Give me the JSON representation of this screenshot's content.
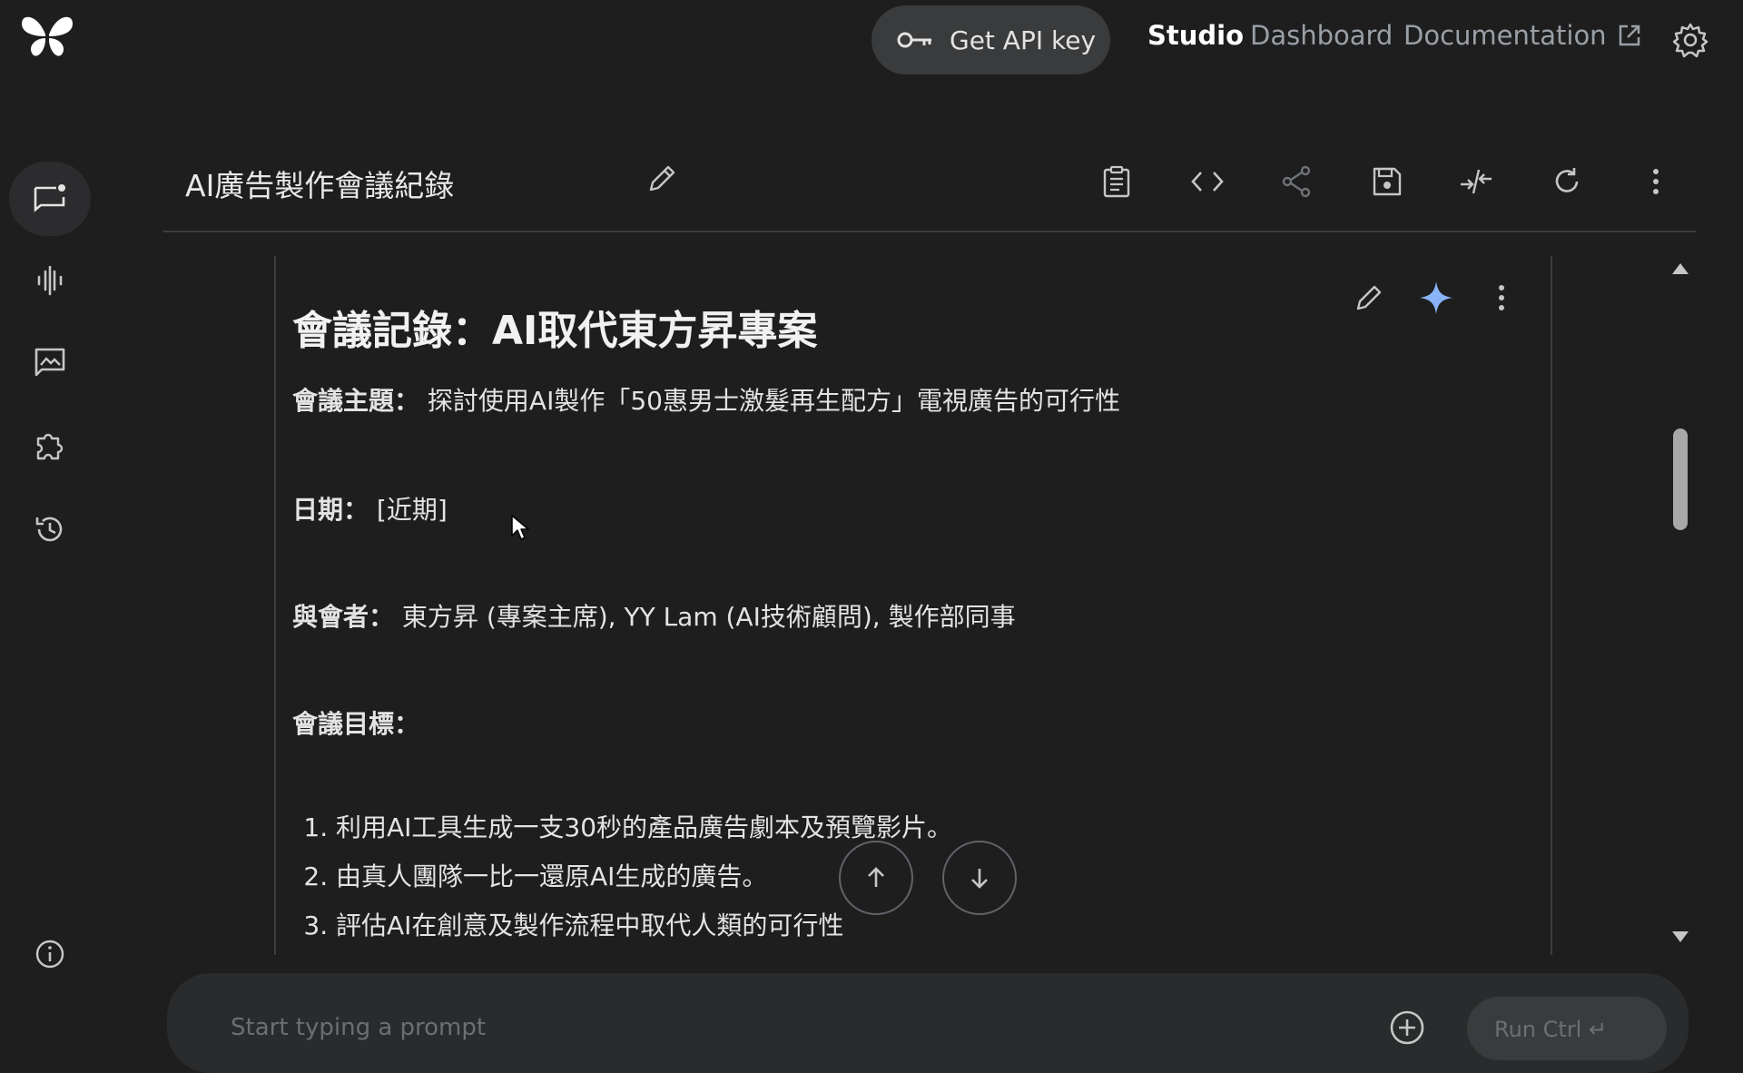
{
  "header": {
    "api_key_label": "Get API key",
    "nav": {
      "studio": "Studio",
      "dashboard": "Dashboard",
      "documentation": "Documentation"
    }
  },
  "title_bar": {
    "title": "AI廣告製作會議紀錄"
  },
  "document": {
    "heading": "會議記錄：AI取代東方昇專案",
    "topic_label": "會議主題：",
    "topic_value": "探討使用AI製作「50惠男士激髮再生配方」電視廣告的可行性",
    "date_label": "日期：",
    "date_value": "[近期]",
    "attendees_label": "與會者：",
    "attendees_value": "東方昇 (專案主席), YY Lam (AI技術顧問), 製作部同事",
    "goals_label": "會議目標：",
    "goals": [
      "利用AI工具生成一支30秒的產品廣告劇本及預覽影片。",
      "由真人團隊一比一還原AI生成的廣告。",
      "評估AI在創意及製作流程中取代人類的可行性"
    ]
  },
  "prompt": {
    "placeholder": "Start typing a prompt",
    "run_label": "Run Ctrl ↵"
  },
  "colors": {
    "background": "#1e1e1f",
    "accent_star": "#8ab4f8"
  }
}
